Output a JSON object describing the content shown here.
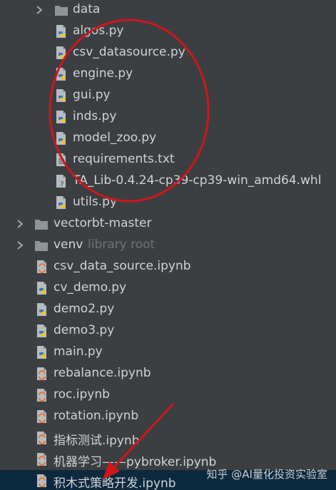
{
  "rows": [
    {
      "kind": "folder",
      "label": "data",
      "hint": "",
      "expander": "collapsed"
    },
    {
      "kind": "python",
      "label": "algos.py",
      "hint": ""
    },
    {
      "kind": "python",
      "label": "csv_datasource.py",
      "hint": ""
    },
    {
      "kind": "python",
      "label": "engine.py",
      "hint": ""
    },
    {
      "kind": "python",
      "label": "gui.py",
      "hint": ""
    },
    {
      "kind": "python",
      "label": "inds.py",
      "hint": ""
    },
    {
      "kind": "python",
      "label": "model_zoo.py",
      "hint": ""
    },
    {
      "kind": "text",
      "label": "requirements.txt",
      "hint": ""
    },
    {
      "kind": "unknown",
      "label": "TA_Lib-0.4.24-cp39-cp39-win_amd64.whl",
      "hint": ""
    },
    {
      "kind": "python",
      "label": "utils.py",
      "hint": ""
    },
    {
      "kind": "folder",
      "label": "vectorbt-master",
      "hint": "",
      "expander": "collapsed"
    },
    {
      "kind": "folder",
      "label": "venv",
      "hint": "library root",
      "expander": "collapsed"
    },
    {
      "kind": "notebook",
      "label": "csv_data_source.ipynb",
      "hint": ""
    },
    {
      "kind": "python",
      "label": "cv_demo.py",
      "hint": ""
    },
    {
      "kind": "python",
      "label": "demo2.py",
      "hint": ""
    },
    {
      "kind": "python",
      "label": "demo3.py",
      "hint": ""
    },
    {
      "kind": "python",
      "label": "main.py",
      "hint": ""
    },
    {
      "kind": "notebook",
      "label": "rebalance.ipynb",
      "hint": ""
    },
    {
      "kind": "notebook",
      "label": "roc.ipynb",
      "hint": ""
    },
    {
      "kind": "notebook",
      "label": "rotation.ipynb",
      "hint": ""
    },
    {
      "kind": "notebook",
      "label": "指标测试.ipynb",
      "hint": ""
    },
    {
      "kind": "notebook",
      "label": "机器学习——pybroker.ipynb",
      "hint": ""
    },
    {
      "kind": "notebook",
      "label": "积木式策略开发.ipynb",
      "hint": "",
      "selected": true
    }
  ],
  "watermark": "知乎 @AI量化投资实验室",
  "colors": {
    "background": "#3c3f41",
    "selected_row": "#0d293e",
    "text": "#d0d3d6",
    "hint_text": "#6d7377",
    "annotation_red": "#d0161d"
  },
  "annotations": {
    "ellipse": "red-ellipse-around-py-files",
    "arrow": "red-arrow-to-selected-notebook"
  }
}
